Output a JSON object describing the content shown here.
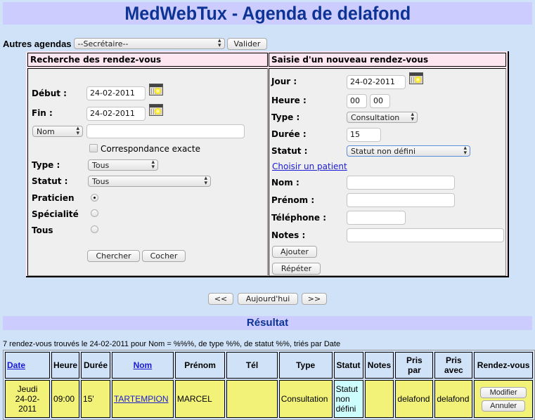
{
  "header": {
    "title": "MedWebTux - Agenda de delafond"
  },
  "agendas": {
    "label": "Autres agendas",
    "selected": "--Secrétaire--",
    "validate_label": "Valider"
  },
  "search": {
    "title": "Recherche des rendez-vous",
    "start_label": "Début :",
    "start_value": "24-02-2011",
    "end_label": "Fin :",
    "end_value": "24-02-2011",
    "field_select": "Nom",
    "field_value": "",
    "exact_label": "Correspondance exacte",
    "exact_checked": false,
    "type_label": "Type :",
    "type_value": "Tous",
    "status_label": "Statut :",
    "status_value": "Tous",
    "scope": [
      {
        "label": "Praticien",
        "checked": true
      },
      {
        "label": "Spécialité",
        "checked": false
      },
      {
        "label": "Tous",
        "checked": false
      }
    ],
    "search_button": "Chercher",
    "check_button": "Cocher"
  },
  "new_appointment": {
    "title": "Saisie d'un nouveau rendez-vous",
    "day_label": "Jour :",
    "day_value": "24-02-2011",
    "hour_label": "Heure :",
    "hour_value": "00",
    "minute_value": "00",
    "type_label": "Type :",
    "type_value": "Consultation",
    "duration_label": "Durée :",
    "duration_value": "15",
    "status_label": "Statut :",
    "status_value": "Statut non défini",
    "choose_patient_link": "Choisir un patient",
    "lastname_label": "Nom :",
    "lastname_value": "",
    "firstname_label": "Prénom :",
    "firstname_value": "",
    "phone_label": "Téléphone :",
    "phone_value": "",
    "notes_label": "Notes :",
    "notes_value": "",
    "add_button": "Ajouter",
    "repeat_button": "Répéter"
  },
  "navigation": {
    "prev": "<<",
    "today": "Aujourd'hui",
    "next": ">>"
  },
  "results": {
    "title": "Résultat",
    "summary": "7 rendez-vous trouvés le 24-02-2011 pour Nom = %%%, de type %%, de statut %%, triés par Date",
    "columns": {
      "date": "Date",
      "hour": "Heure",
      "duration": "Durée",
      "lastname": "Nom",
      "firstname": "Prénom",
      "phone": "Tél",
      "type": "Type",
      "status": "Statut",
      "notes": "Notes",
      "taken_by_1": "Pris",
      "taken_by_2": "par",
      "taken_with_1": "Pris",
      "taken_with_2": "avec",
      "appointment": "Rendez-vous"
    },
    "rows": [
      {
        "day": "Jeudi",
        "date": "24-02-2011",
        "hour": "09:00",
        "duration": "15'",
        "lastname": "TARTEMPION",
        "firstname": "MARCEL",
        "phone": "",
        "type": "Consultation",
        "status_1": "Statut",
        "status_2": "non",
        "status_3": "défini",
        "notes": "",
        "taken_by": "delafond",
        "taken_with": "delafond",
        "modify_button": "Modifier",
        "cancel_button": "Annuler"
      }
    ]
  },
  "colors": {
    "page_bg": "#cfe2f7",
    "title_bar": "#ccccff",
    "title_text": "#0d3394",
    "panel_header": "#fde6f0",
    "row_bg": "#f2f278",
    "status_cell": "#cdfdfd",
    "link": "#1a1ad6"
  }
}
